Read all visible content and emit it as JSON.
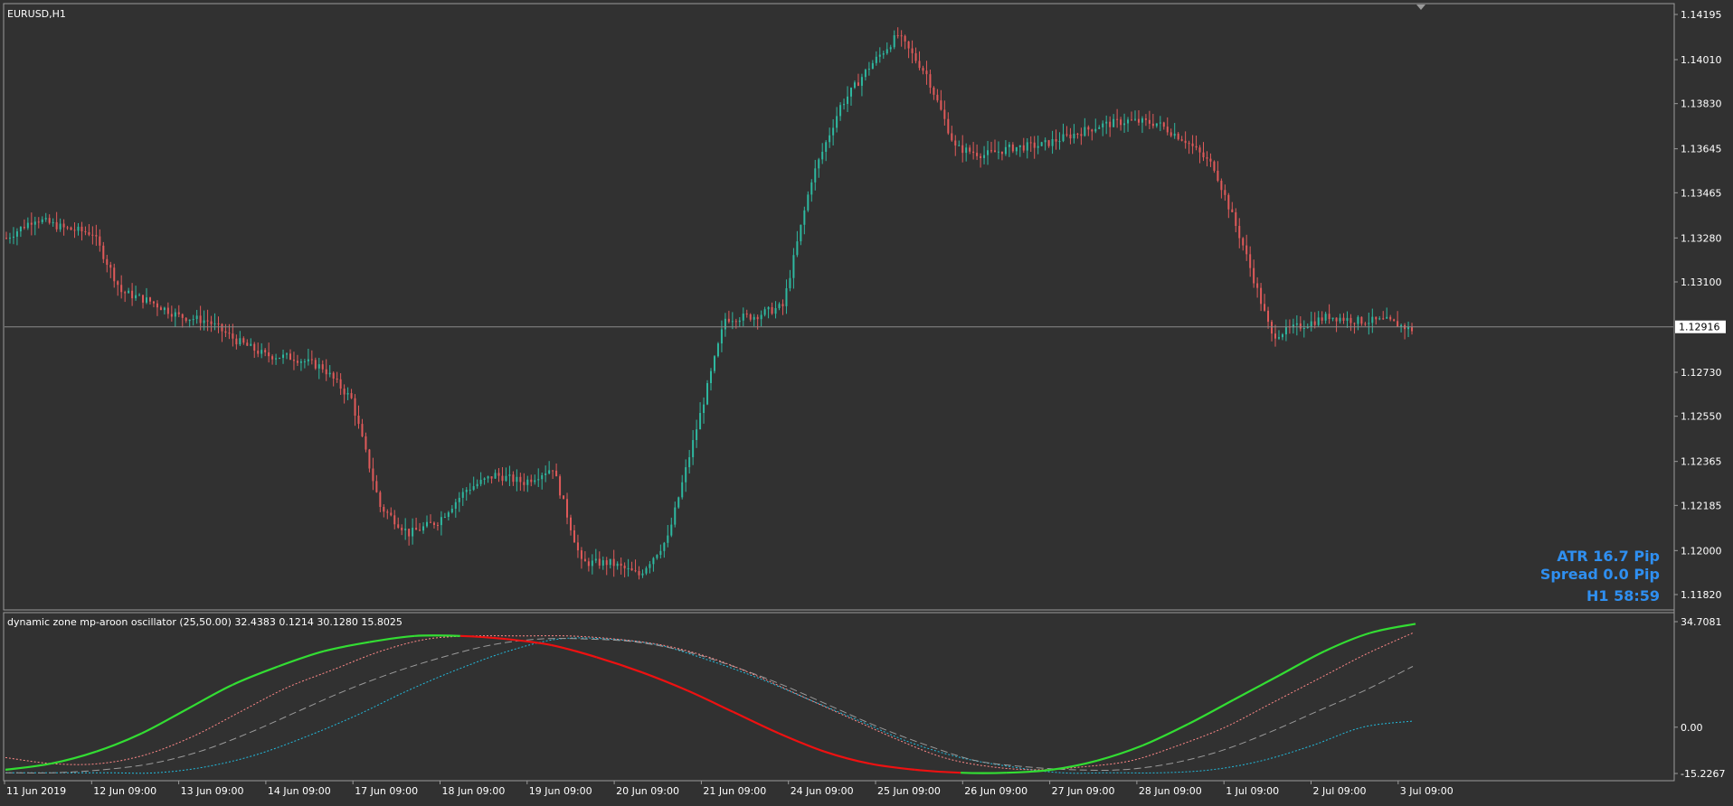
{
  "chart": {
    "symbol_label": "EURUSD,H1",
    "price_ticks": [
      "1.14195",
      "1.14010",
      "1.13830",
      "1.13645",
      "1.13465",
      "1.13280",
      "1.13100",
      "1.12730",
      "1.12550",
      "1.12365",
      "1.12185",
      "1.12000",
      "1.11820"
    ],
    "current_price": "1.12916",
    "price_min": 1.1174,
    "price_max": 1.1424
  },
  "info": {
    "atr": "ATR 16.7 Pip",
    "spread": "Spread 0.0 Pip",
    "timer": "H1 58:59"
  },
  "indicator": {
    "title": "dynamic zone mp-aroon oscillator (25,50.00) 32.4383 0.1214 30.1280 15.8025",
    "ticks": [
      "34.7081",
      "0.00",
      "-15.2267"
    ]
  },
  "time_axis": {
    "labels": [
      "11 Jun 2019",
      "12 Jun 09:00",
      "13 Jun 09:00",
      "14 Jun 09:00",
      "17 Jun 09:00",
      "18 Jun 09:00",
      "19 Jun 09:00",
      "20 Jun 09:00",
      "21 Jun 09:00",
      "24 Jun 09:00",
      "25 Jun 09:00",
      "26 Jun 09:00",
      "27 Jun 09:00",
      "28 Jun 09:00",
      "1 Jul 09:00",
      "2 Jul 09:00",
      "3 Jul 09:00"
    ]
  },
  "chart_data": {
    "type": "candlestick",
    "symbol": "EURUSD",
    "timeframe": "H1",
    "close_path": [
      [
        0,
        1.1328
      ],
      [
        8,
        1.1336
      ],
      [
        16,
        1.1332
      ],
      [
        24,
        1.133
      ],
      [
        32,
        1.1306
      ],
      [
        40,
        1.1302
      ],
      [
        48,
        1.1296
      ],
      [
        56,
        1.1294
      ],
      [
        64,
        1.1286
      ],
      [
        72,
        1.128
      ],
      [
        80,
        1.1279
      ],
      [
        88,
        1.1275
      ],
      [
        96,
        1.1262
      ],
      [
        104,
        1.1218
      ],
      [
        112,
        1.1207
      ],
      [
        120,
        1.1212
      ],
      [
        128,
        1.1225
      ],
      [
        136,
        1.1231
      ],
      [
        144,
        1.1228
      ],
      [
        152,
        1.1234
      ],
      [
        160,
        1.1195
      ],
      [
        168,
        1.1195
      ],
      [
        176,
        1.119
      ],
      [
        184,
        1.1205
      ],
      [
        192,
        1.125
      ],
      [
        200,
        1.1295
      ],
      [
        208,
        1.1296
      ],
      [
        216,
        1.13
      ],
      [
        224,
        1.1352
      ],
      [
        232,
        1.1382
      ],
      [
        240,
        1.1398
      ],
      [
        248,
        1.1411
      ],
      [
        256,
        1.1395
      ],
      [
        264,
        1.1365
      ],
      [
        272,
        1.1362
      ],
      [
        280,
        1.1365
      ],
      [
        288,
        1.1366
      ],
      [
        296,
        1.137
      ],
      [
        304,
        1.1374
      ],
      [
        312,
        1.1376
      ],
      [
        320,
        1.1375
      ],
      [
        328,
        1.1368
      ],
      [
        336,
        1.1357
      ],
      [
        344,
        1.1325
      ],
      [
        352,
        1.1288
      ],
      [
        360,
        1.1292
      ],
      [
        368,
        1.1296
      ],
      [
        376,
        1.1294
      ],
      [
        384,
        1.1294
      ],
      [
        392,
        1.129
      ]
    ],
    "indicator_series": [
      {
        "name": "main",
        "color": "#33dd33/#ee1111",
        "values": [
          -14,
          -12,
          -8,
          -2,
          6,
          14,
          20,
          25,
          28,
          30,
          30,
          29,
          27,
          23,
          18,
          12,
          5,
          -2,
          -8,
          -12,
          -14,
          -15,
          -15,
          -14,
          -11,
          -6,
          1,
          9,
          17,
          25,
          31,
          34
        ]
      },
      {
        "name": "signal",
        "color": "#ff8888",
        "values": [
          -10,
          -12,
          -12,
          -9,
          -3,
          5,
          13,
          19,
          25,
          29,
          30,
          30,
          30,
          29,
          27,
          23,
          17,
          10,
          3,
          -4,
          -10,
          -13,
          -14,
          -13,
          -11,
          -6,
          0,
          8,
          16,
          24,
          31
        ]
      },
      {
        "name": "middle",
        "color": "#999999",
        "values": [
          -15,
          -15,
          -14,
          -12,
          -8,
          -2,
          5,
          12,
          18,
          23,
          27,
          29,
          29,
          28,
          25,
          20,
          14,
          7,
          0,
          -6,
          -11,
          -13,
          -14,
          -14,
          -12,
          -8,
          -2,
          5,
          12,
          20
        ]
      },
      {
        "name": "lower",
        "color": "#22bbdd",
        "values": [
          -15,
          -15,
          -15,
          -15,
          -13,
          -9,
          -3,
          4,
          12,
          19,
          25,
          29,
          29,
          27,
          22,
          16,
          9,
          2,
          -5,
          -10,
          -13,
          -15,
          -15,
          -15,
          -14,
          -11,
          -6,
          0,
          2
        ]
      }
    ],
    "ylim_price": [
      1.1174,
      1.1424
    ],
    "ylim_indicator": [
      -15.2267,
      34.7081
    ]
  }
}
